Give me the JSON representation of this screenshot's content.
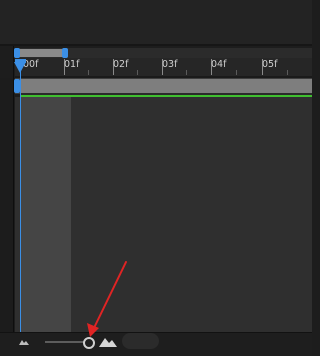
{
  "ruler": {
    "labels": [
      "00f",
      "01f",
      "02f",
      "03f",
      "04f",
      "05f"
    ]
  },
  "playhead": {
    "frame": "00f"
  },
  "zoom": {
    "level": 0.85
  },
  "colors": {
    "playhead": "#3b8fe6",
    "layer_bar": "#7e7e7e",
    "green_line": "#3fbf2f",
    "annotation_arrow": "#e02424"
  },
  "icons": {
    "zoom_out": "small-mountain-icon",
    "zoom_in": "large-mountain-icon"
  }
}
